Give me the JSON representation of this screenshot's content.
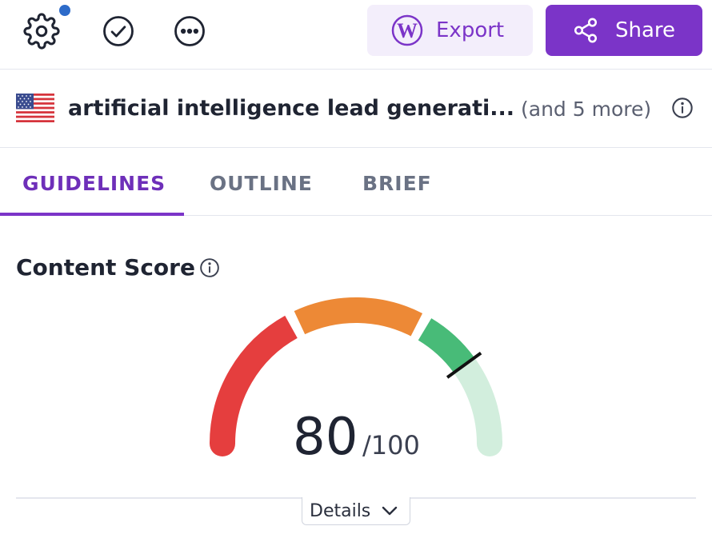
{
  "toolbar": {
    "settings_icon": "gear-icon",
    "check_icon": "check-circle-icon",
    "more_icon": "more-horizontal-icon",
    "export_label": "Export",
    "export_icon": "wordpress-icon",
    "share_label": "Share",
    "share_icon": "share-icon",
    "notification_color": "#2d6bc9"
  },
  "keyword": {
    "flag_icon": "us-flag-icon",
    "text": "artificial intelligence lead generati...",
    "more": "(and 5 more)",
    "info_icon": "info-icon"
  },
  "tabs": [
    {
      "label": "GUIDELINES",
      "active": true
    },
    {
      "label": "OUTLINE",
      "active": false
    },
    {
      "label": "BRIEF",
      "active": false
    }
  ],
  "content_score": {
    "title": "Content Score",
    "info_icon": "info-icon",
    "score": "80",
    "max": "/100",
    "score_value": 80,
    "score_max": 100,
    "details_label": "Details",
    "details_icon": "chevron-down-icon"
  },
  "colors": {
    "accent": "#7b34c8",
    "export_bg": "#f3eefb",
    "gauge_red": "#e53e3e",
    "gauge_orange": "#ed8936",
    "gauge_green": "#48bb78",
    "gauge_light_green": "#d2eedd"
  }
}
